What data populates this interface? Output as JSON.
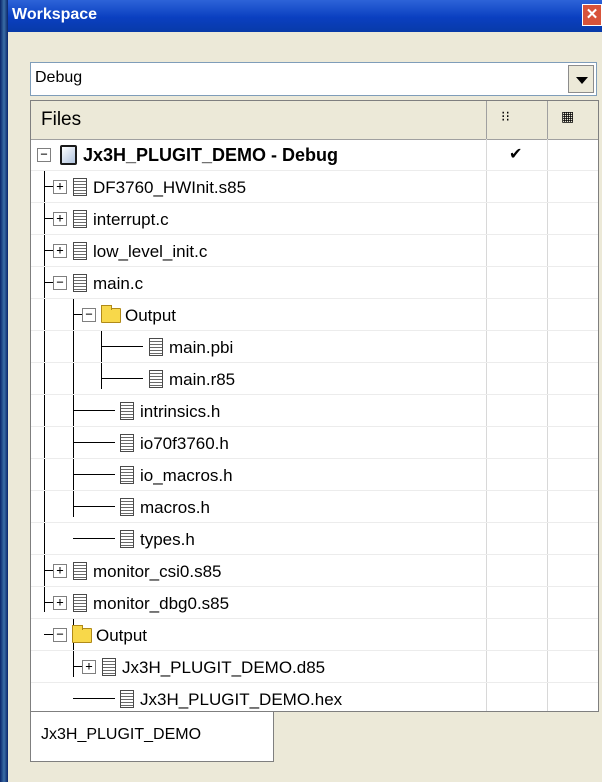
{
  "window": {
    "title": "Workspace",
    "close_symbol": "✕"
  },
  "config": {
    "selected": "Debug"
  },
  "panel": {
    "header_label": "Files",
    "col2_icon": "⁝⁝",
    "col3_icon": "▦"
  },
  "tree": {
    "project": {
      "label": "Jx3H_PLUGIT_DEMO - Debug",
      "check": "✔"
    },
    "items": [
      {
        "label": "DF3760_HWInit.s85",
        "exp": "+"
      },
      {
        "label": "interrupt.c",
        "exp": "+"
      },
      {
        "label": "low_level_init.c",
        "exp": "+"
      },
      {
        "label": "main.c",
        "exp": "−"
      },
      {
        "label": "Output",
        "exp": "−"
      },
      {
        "label": "main.pbi"
      },
      {
        "label": "main.r85"
      },
      {
        "label": "intrinsics.h"
      },
      {
        "label": "io70f3760.h"
      },
      {
        "label": "io_macros.h"
      },
      {
        "label": "macros.h"
      },
      {
        "label": "types.h"
      },
      {
        "label": "monitor_csi0.s85",
        "exp": "+"
      },
      {
        "label": "monitor_dbg0.s85",
        "exp": "+"
      },
      {
        "label": "Output",
        "exp": "−"
      },
      {
        "label": "Jx3H_PLUGIT_DEMO.d85",
        "exp": "+"
      },
      {
        "label": "Jx3H_PLUGIT_DEMO.hex"
      }
    ]
  },
  "tabs": {
    "active": "Jx3H_PLUGIT_DEMO"
  }
}
